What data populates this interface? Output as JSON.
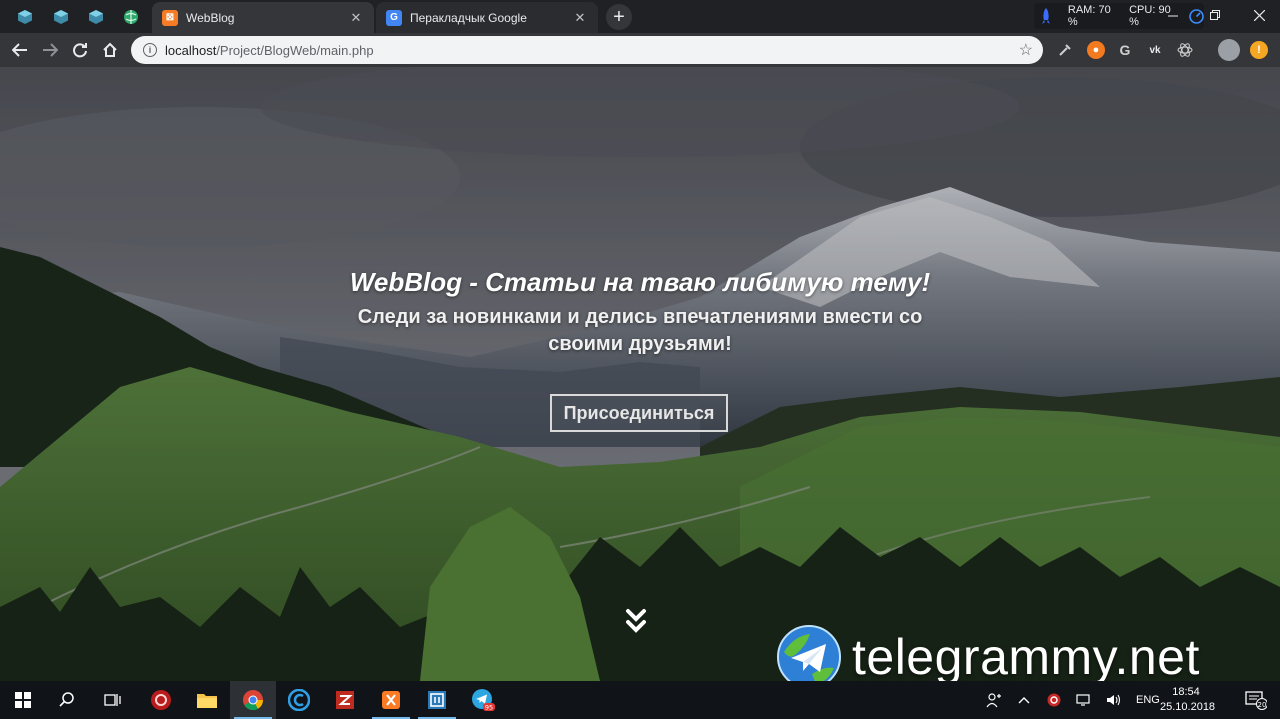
{
  "browser": {
    "tabs": [
      {
        "title": "WebBlog",
        "active": true
      },
      {
        "title": "Перакладчык Google",
        "active": false
      }
    ],
    "new_tab_label": "+",
    "system_monitor": {
      "ram": "RAM: 70 %",
      "cpu": "CPU: 90 %"
    },
    "url": {
      "host": "localhost",
      "path": "/Project/BlogWeb/main.php"
    }
  },
  "hero": {
    "title": "WebBlog - Статьи на тваю либимую тему!",
    "subtitle": "Следи за новинками и делись впечатлениями вмести со своими друзьями!",
    "join_label": "Присоединиться"
  },
  "watermark": {
    "text": "telegrammy.net"
  },
  "taskbar": {
    "language": "ENG",
    "time": "18:54",
    "date": "25.10.2018",
    "notification_count": "20",
    "telegram_badge": "95"
  },
  "colors": {
    "tab_active": "#35363a",
    "tab_strip": "#202124",
    "omnibox": "#f1f3f4",
    "taskbar": "#101317"
  }
}
